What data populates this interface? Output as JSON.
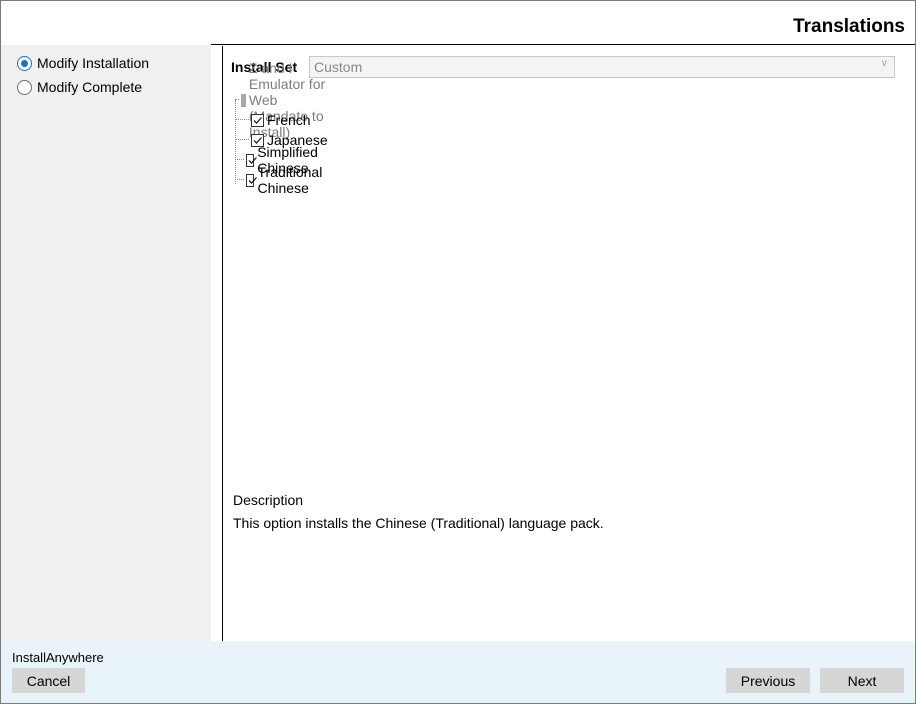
{
  "window": {
    "title": "Translations"
  },
  "options": [
    {
      "label": "Modify Installation",
      "selected": true
    },
    {
      "label": "Modify Complete",
      "selected": false
    }
  ],
  "install_set": {
    "label": "Install Set",
    "value": "Custom"
  },
  "tree": [
    {
      "label": "Z and I Emulator for Web (Mandate to Install)",
      "checked": true,
      "disabled": true
    },
    {
      "label": "French",
      "checked": true,
      "disabled": false
    },
    {
      "label": "Japanese",
      "checked": true,
      "disabled": false
    },
    {
      "label": "Simplified Chinese",
      "checked": true,
      "disabled": false
    },
    {
      "label": "Traditional Chinese",
      "checked": true,
      "disabled": false
    }
  ],
  "description": {
    "title": "Description",
    "text": "This option installs the Chinese (Traditional) language pack."
  },
  "footer": {
    "brand": "InstallAnywhere",
    "cancel": "Cancel",
    "previous": "Previous",
    "next": "Next"
  },
  "colors": {
    "accent": "#1a6fd8",
    "footer_bg": "#e9f3fa",
    "sidebar_bg": "#f0f0f0",
    "button_bg": "#d6d6d6"
  }
}
